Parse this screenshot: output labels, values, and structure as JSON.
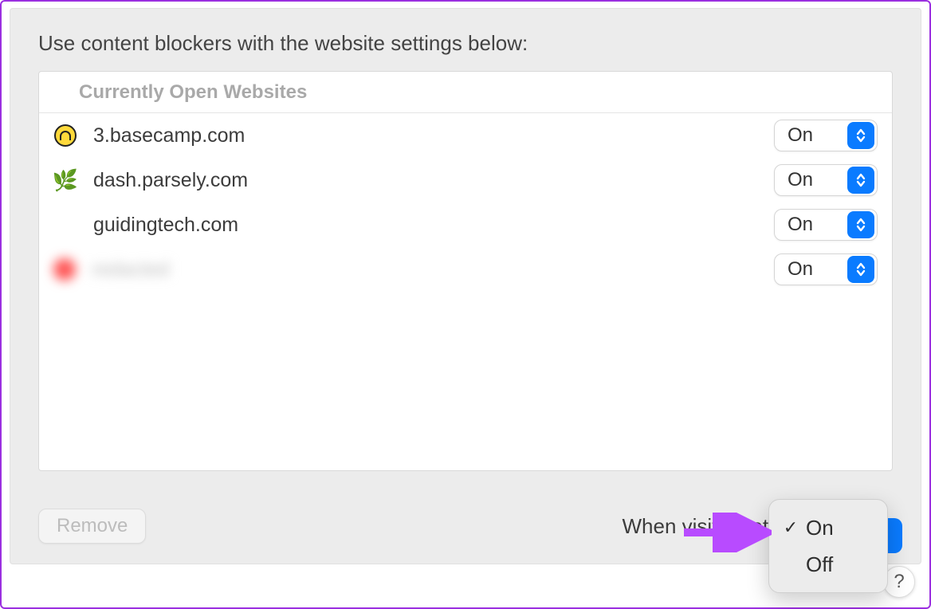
{
  "heading": "Use content blockers with the website settings below:",
  "listHeader": "Currently Open Websites",
  "sites": [
    {
      "name": "3.basecamp.com",
      "value": "On",
      "icon": "basecamp"
    },
    {
      "name": "dash.parsely.com",
      "value": "On",
      "icon": "parsely"
    },
    {
      "name": "guidingtech.com",
      "value": "On",
      "icon": ""
    },
    {
      "name": "redacted",
      "value": "On",
      "icon": "redacted",
      "blurred": true
    }
  ],
  "removeLabel": "Remove",
  "otherLabel": "When visiting other websites",
  "popover": {
    "options": [
      {
        "label": "On",
        "selected": true
      },
      {
        "label": "Off",
        "selected": false
      }
    ]
  },
  "helpLabel": "?"
}
